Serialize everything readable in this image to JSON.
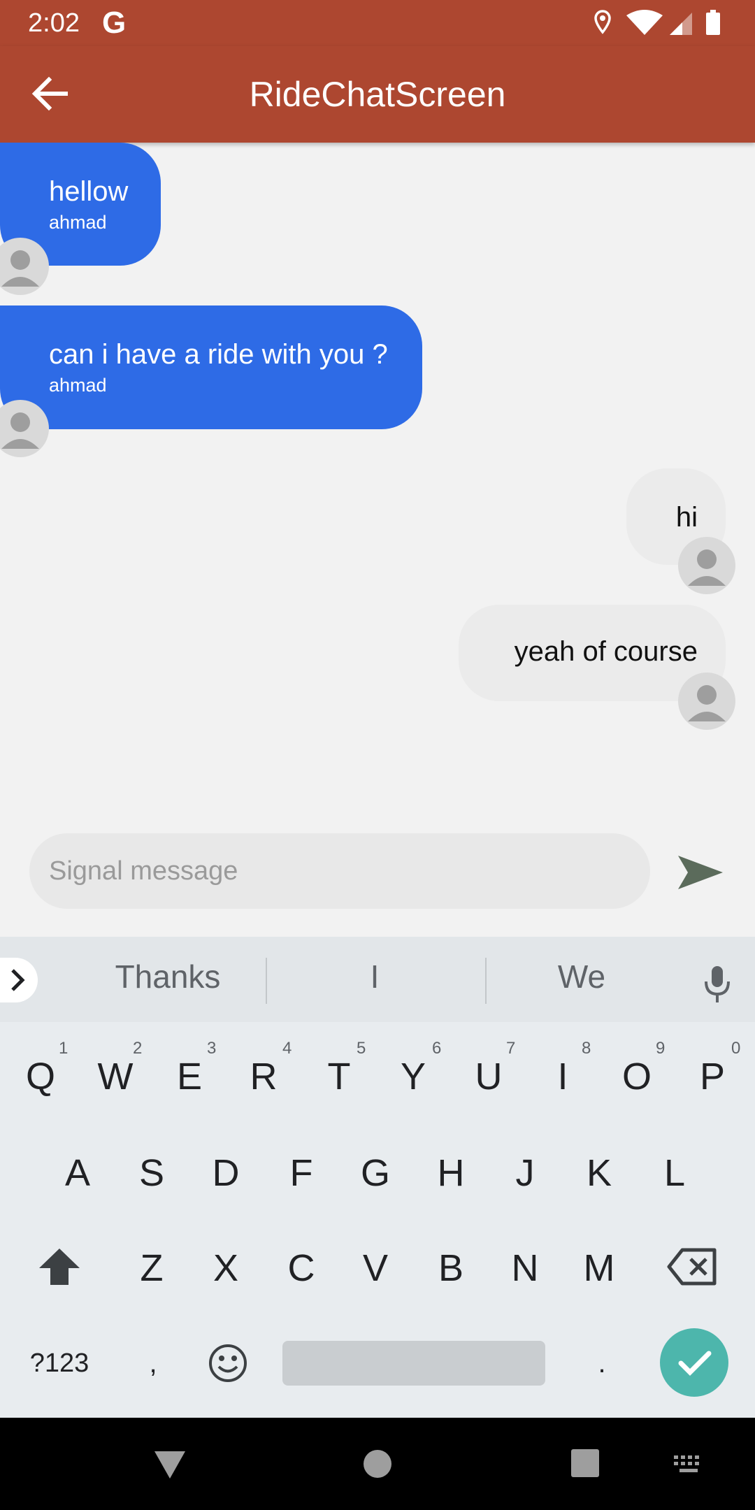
{
  "status_bar": {
    "time": "2:02",
    "g_logo": "G",
    "icons": [
      "location-icon",
      "wifi-icon",
      "signal-icon",
      "battery-icon"
    ]
  },
  "app_bar": {
    "title": "RideChatScreen",
    "back_icon": "arrow-left-icon"
  },
  "messages": [
    {
      "direction": "incoming",
      "text": "hellow",
      "author": "ahmad"
    },
    {
      "direction": "incoming",
      "text": "can i have a ride with you ?",
      "author": "ahmad"
    },
    {
      "direction": "outgoing",
      "text": "hi"
    },
    {
      "direction": "outgoing",
      "text": "yeah of course"
    }
  ],
  "composer": {
    "placeholder": "Signal message",
    "value": "",
    "send_icon": "send-icon"
  },
  "keyboard": {
    "suggestions": [
      "Thanks",
      "I",
      "We"
    ],
    "row1": [
      "Q",
      "W",
      "E",
      "R",
      "T",
      "Y",
      "U",
      "I",
      "O",
      "P"
    ],
    "row1_hints": [
      "1",
      "2",
      "3",
      "4",
      "5",
      "6",
      "7",
      "8",
      "9",
      "0"
    ],
    "row2": [
      "A",
      "S",
      "D",
      "F",
      "G",
      "H",
      "J",
      "K",
      "L"
    ],
    "row3": [
      "Z",
      "X",
      "C",
      "V",
      "B",
      "N",
      "M"
    ],
    "symbols_key": "?123",
    "comma_key": ",",
    "period_key": "."
  },
  "colors": {
    "app_bar": "#ad4730",
    "incoming_bubble": "#2e6be6",
    "outgoing_bubble": "#ebebeb",
    "enter_key": "#4db6ac",
    "send_icon": "#5b6b5b"
  }
}
